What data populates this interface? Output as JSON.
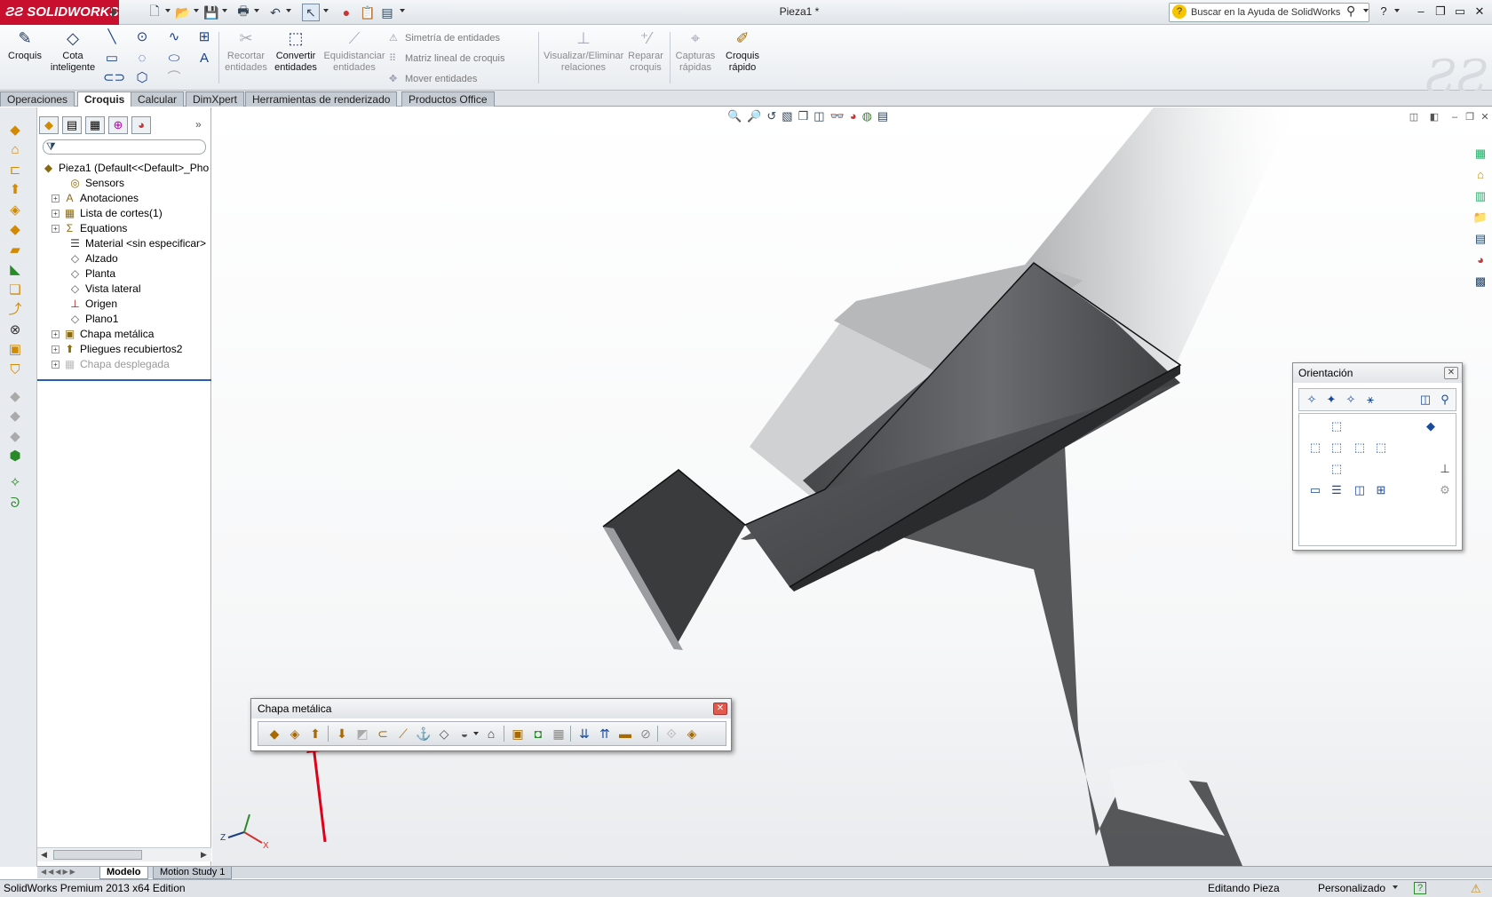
{
  "app": {
    "logo_text": "SOLIDWORKS",
    "document_title": "Pieza1 *",
    "brand_color": "#c8102e"
  },
  "search": {
    "placeholder": "Buscar en la Ayuda de SolidWorks"
  },
  "ribbon": {
    "croquis": "Croquis",
    "cota": "Cota inteligente",
    "recortar": "Recortar entidades",
    "convertir": "Convertir entidades",
    "equidistanciar": "Equidistanciar entidades",
    "simetria": "Simetría de entidades",
    "matriz": "Matriz lineal de croquis",
    "mover": "Mover entidades",
    "visualizar": "Visualizar/Eliminar relaciones",
    "reparar": "Reparar croquis",
    "capturas": "Capturas rápidas",
    "croquis_rapido": "Croquis rápido"
  },
  "tabs": [
    "Operaciones",
    "Croquis",
    "Calcular",
    "DimXpert",
    "Herramientas de renderizado",
    "Productos Office"
  ],
  "active_tab": "Croquis",
  "tree": {
    "root": "Pieza1  (Default<<Default>_Pho",
    "items": [
      {
        "label": "Sensors",
        "expand": false,
        "icon": "sensor-icon"
      },
      {
        "label": "Anotaciones",
        "expand": true,
        "icon": "annotation-icon"
      },
      {
        "label": "Lista de cortes(1)",
        "expand": true,
        "icon": "cutlist-icon"
      },
      {
        "label": "Equations",
        "expand": true,
        "icon": "equation-icon"
      },
      {
        "label": "Material <sin especificar>",
        "expand": false,
        "icon": "material-icon"
      },
      {
        "label": "Alzado",
        "expand": false,
        "icon": "plane-icon"
      },
      {
        "label": "Planta",
        "expand": false,
        "icon": "plane-icon"
      },
      {
        "label": "Vista lateral",
        "expand": false,
        "icon": "plane-icon"
      },
      {
        "label": "Origen",
        "expand": false,
        "icon": "origin-icon"
      },
      {
        "label": "Plano1",
        "expand": false,
        "icon": "plane-icon"
      },
      {
        "label": "Chapa metálica",
        "expand": true,
        "icon": "sheetmetal-icon"
      },
      {
        "label": "Pliegues recubiertos2",
        "expand": true,
        "icon": "bend-icon"
      },
      {
        "label": "Chapa desplegada",
        "expand": true,
        "icon": "flat-pattern-icon",
        "suppressed": true
      }
    ]
  },
  "orientation_panel": {
    "title": "Orientación"
  },
  "sheetmetal_toolbar": {
    "title": "Chapa metálica"
  },
  "bottom_tabs": [
    "Modelo",
    "Motion Study 1"
  ],
  "status": {
    "left": "SolidWorks Premium 2013 x64 Edition",
    "mode": "Editando Pieza",
    "units": "Personalizado",
    "help": "?"
  },
  "axis": {
    "z": "Z",
    "x": "X"
  }
}
